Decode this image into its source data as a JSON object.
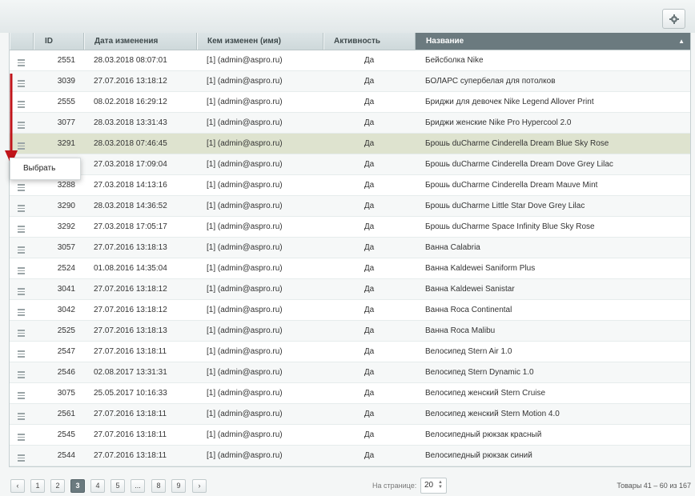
{
  "toolbar": {
    "settings_icon": "gear-icon"
  },
  "columns": {
    "id": "ID",
    "date": "Дата изменения",
    "who": "Кем изменен (имя)",
    "active": "Активность",
    "name": "Название",
    "sort_indicator": "▲"
  },
  "rows": [
    {
      "id": "2551",
      "date": "28.03.2018 08:07:01",
      "who": "[1] (admin@aspro.ru)",
      "active": "Да",
      "name": "Бейсболка Nike"
    },
    {
      "id": "3039",
      "date": "27.07.2016 13:18:12",
      "who": "[1] (admin@aspro.ru)",
      "active": "Да",
      "name": "БОЛАРС супербелая для потолков"
    },
    {
      "id": "2555",
      "date": "08.02.2018 16:29:12",
      "who": "[1] (admin@aspro.ru)",
      "active": "Да",
      "name": "Бриджи для девочек Nike Legend Allover Print"
    },
    {
      "id": "3077",
      "date": "28.03.2018 13:31:43",
      "who": "[1] (admin@aspro.ru)",
      "active": "Да",
      "name": "Бриджи женские Nike Pro Hypercool 2.0"
    },
    {
      "id": "3291",
      "date": "28.03.2018 07:46:45",
      "who": "[1] (admin@aspro.ru)",
      "active": "Да",
      "name": "Брошь duCharme Cinderella Dream Blue Sky Rose"
    },
    {
      "id": "",
      "date": "27.03.2018 17:09:04",
      "who": "[1] (admin@aspro.ru)",
      "active": "Да",
      "name": "Брошь duCharme Cinderella Dream Dove Grey Lilac"
    },
    {
      "id": "3288",
      "date": "27.03.2018 14:13:16",
      "who": "[1] (admin@aspro.ru)",
      "active": "Да",
      "name": "Брошь duCharme Cinderella Dream Mauve Mint"
    },
    {
      "id": "3290",
      "date": "28.03.2018 14:36:52",
      "who": "[1] (admin@aspro.ru)",
      "active": "Да",
      "name": "Брошь duCharme Little Star Dove Grey Lilac"
    },
    {
      "id": "3292",
      "date": "27.03.2018 17:05:17",
      "who": "[1] (admin@aspro.ru)",
      "active": "Да",
      "name": "Брошь duCharme Space Infinity Blue Sky Rose"
    },
    {
      "id": "3057",
      "date": "27.07.2016 13:18:13",
      "who": "[1] (admin@aspro.ru)",
      "active": "Да",
      "name": "Ванна Calabria"
    },
    {
      "id": "2524",
      "date": "01.08.2016 14:35:04",
      "who": "[1] (admin@aspro.ru)",
      "active": "Да",
      "name": "Ванна Kaldewei Saniform Plus"
    },
    {
      "id": "3041",
      "date": "27.07.2016 13:18:12",
      "who": "[1] (admin@aspro.ru)",
      "active": "Да",
      "name": "Ванна Kaldewei Sanistar"
    },
    {
      "id": "3042",
      "date": "27.07.2016 13:18:12",
      "who": "[1] (admin@aspro.ru)",
      "active": "Да",
      "name": "Ванна Roca Continental"
    },
    {
      "id": "2525",
      "date": "27.07.2016 13:18:13",
      "who": "[1] (admin@aspro.ru)",
      "active": "Да",
      "name": "Ванна Roca Malibu"
    },
    {
      "id": "2547",
      "date": "27.07.2016 13:18:11",
      "who": "[1] (admin@aspro.ru)",
      "active": "Да",
      "name": "Велосипед Stern Air 1.0"
    },
    {
      "id": "2546",
      "date": "02.08.2017 13:31:31",
      "who": "[1] (admin@aspro.ru)",
      "active": "Да",
      "name": "Велосипед Stern Dynamic 1.0"
    },
    {
      "id": "3075",
      "date": "25.05.2017 10:16:33",
      "who": "[1] (admin@aspro.ru)",
      "active": "Да",
      "name": "Велосипед женский Stern Cruise"
    },
    {
      "id": "2561",
      "date": "27.07.2016 13:18:11",
      "who": "[1] (admin@aspro.ru)",
      "active": "Да",
      "name": "Велосипед женский Stern Motion 4.0"
    },
    {
      "id": "2545",
      "date": "27.07.2016 13:18:11",
      "who": "[1] (admin@aspro.ru)",
      "active": "Да",
      "name": "Велосипедный рюкзак красный"
    },
    {
      "id": "2544",
      "date": "27.07.2016 13:18:11",
      "who": "[1] (admin@aspro.ru)",
      "active": "Да",
      "name": "Велосипедный рюкзак синий"
    }
  ],
  "selected_row_index": 4,
  "context_menu": {
    "select_label": "Выбрать"
  },
  "pagination": {
    "prev": "‹",
    "pages": [
      "1",
      "2",
      "3",
      "4",
      "5",
      "...",
      "8",
      "9"
    ],
    "current": "3",
    "next": "›",
    "per_page_label": "На странице:",
    "per_page_value": "20",
    "total": "Товары 41 – 60 из 167"
  },
  "colors": {
    "selected_row": "#dee3cf",
    "sorted_header": "#6b7a7f",
    "arrow": "#c0141a"
  }
}
